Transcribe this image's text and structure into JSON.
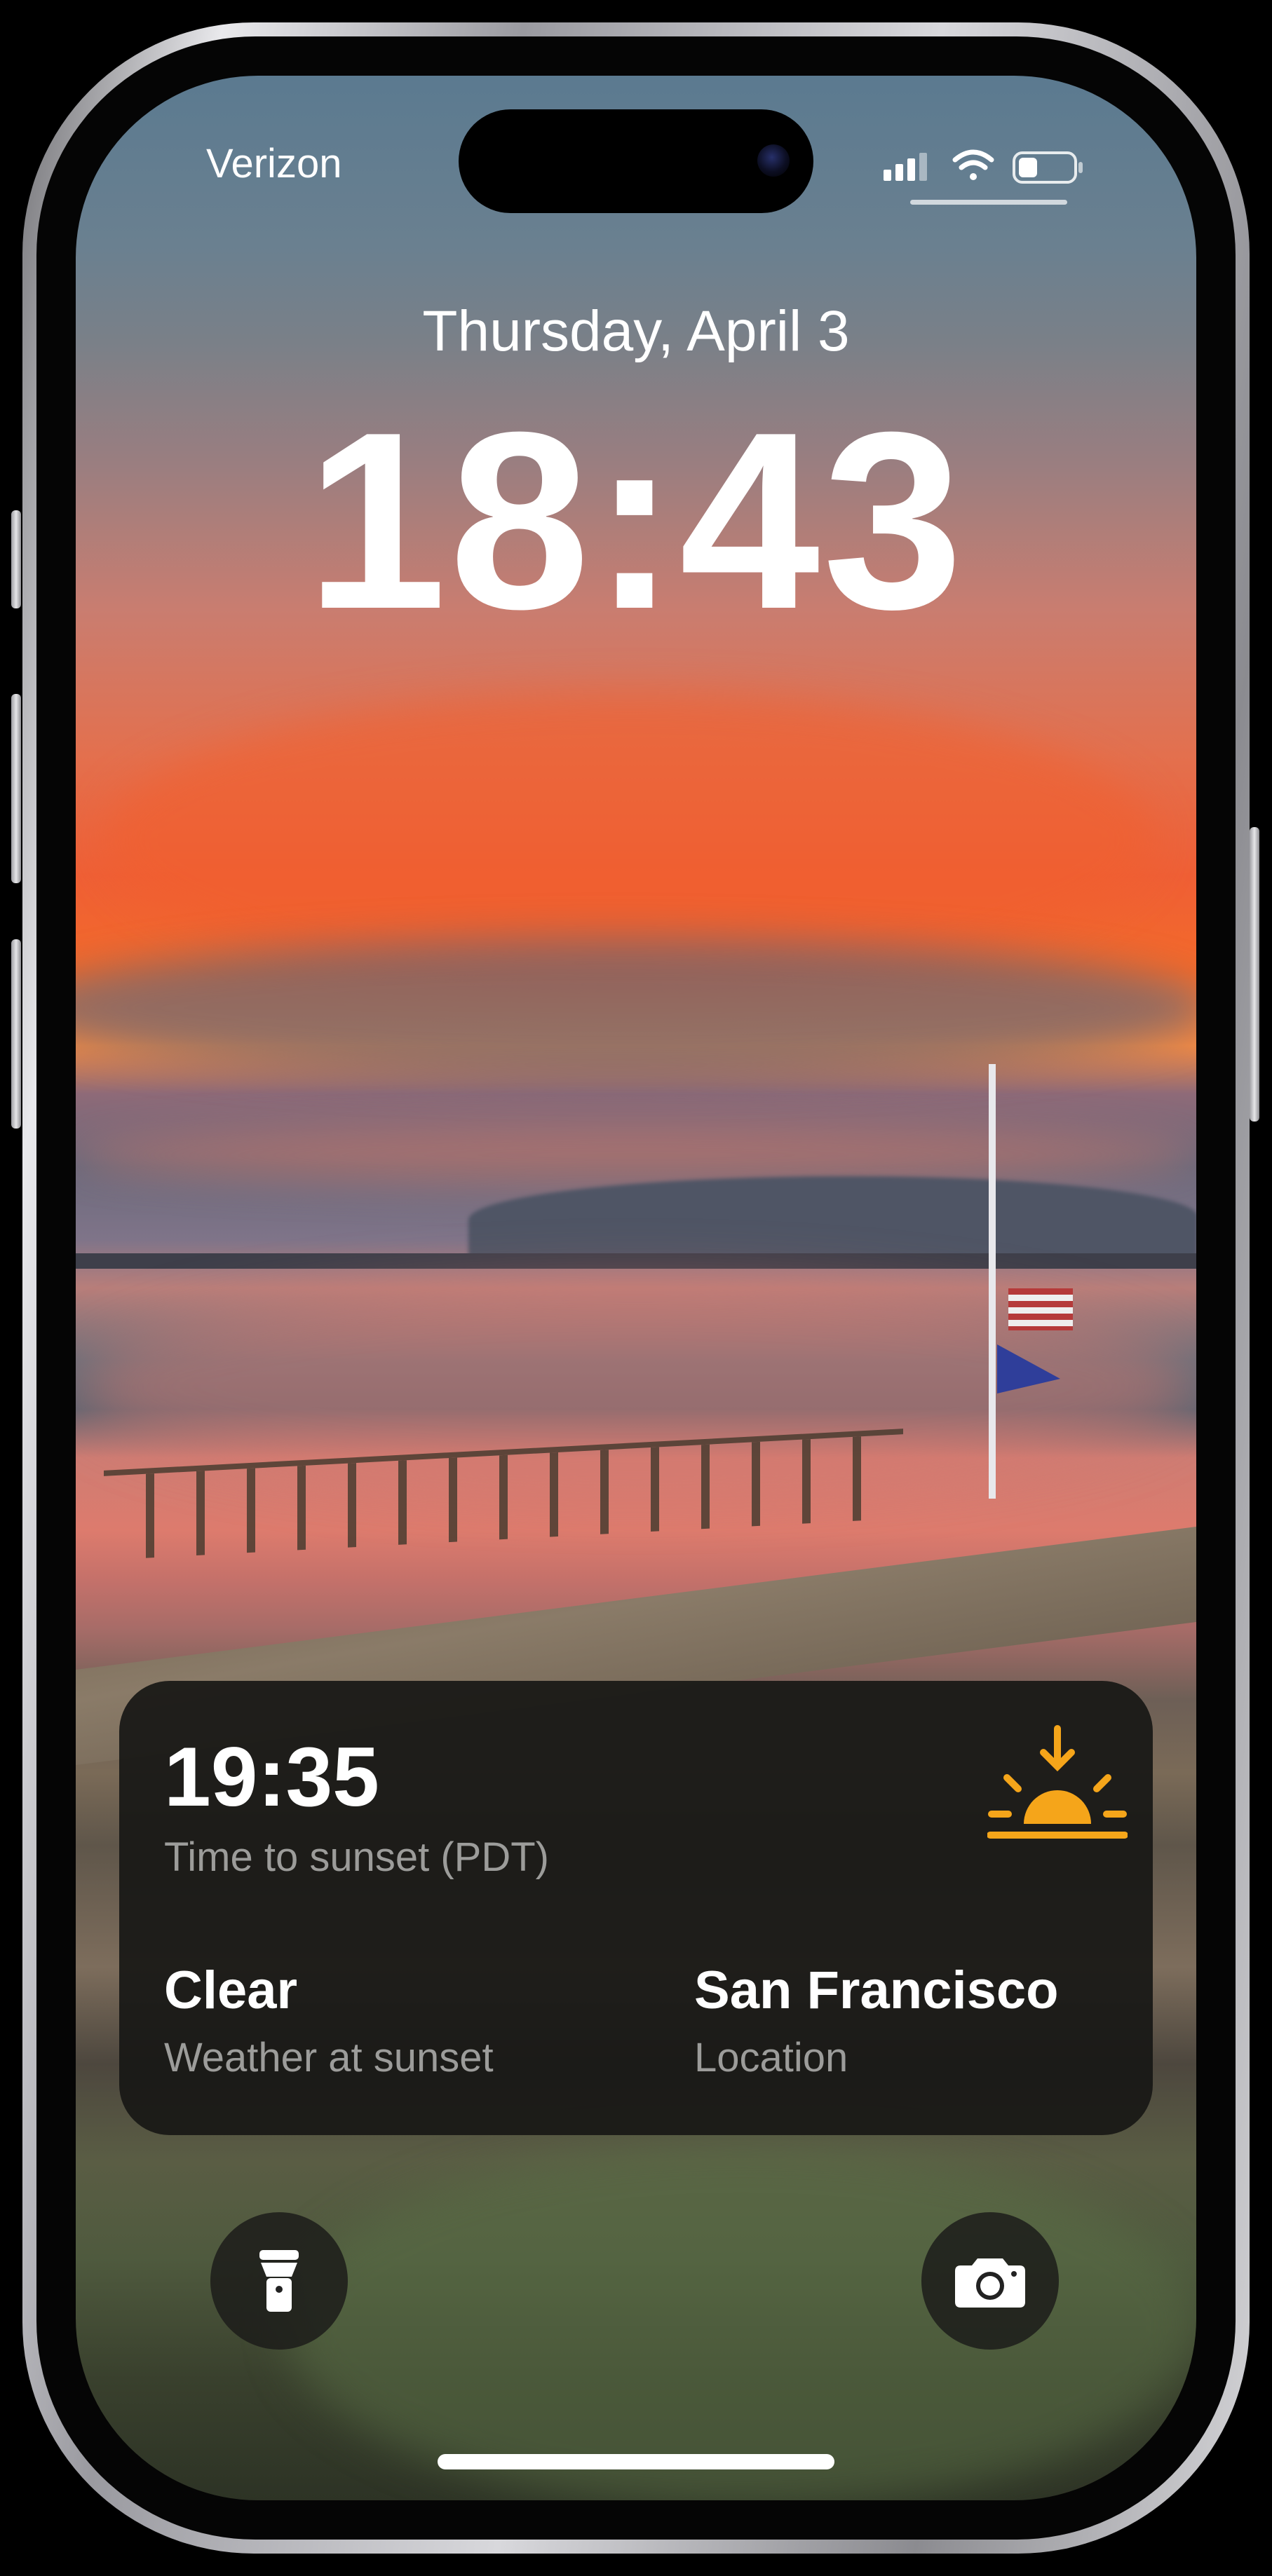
{
  "status_bar": {
    "carrier": "Verizon"
  },
  "lock_screen": {
    "date": "Thursday, April 3",
    "time": "18:43"
  },
  "widget": {
    "sunset_time": "19:35",
    "sunset_time_caption": "Time to sunset (PDT)",
    "weather_value": "Clear",
    "weather_caption": "Weather at sunset",
    "location_value": "San Francisco",
    "location_caption": "Location",
    "icon": "sunset-icon",
    "accent_color": "#f5a51a"
  },
  "quick_actions": {
    "left_icon": "flashlight-icon",
    "right_icon": "camera-icon"
  }
}
